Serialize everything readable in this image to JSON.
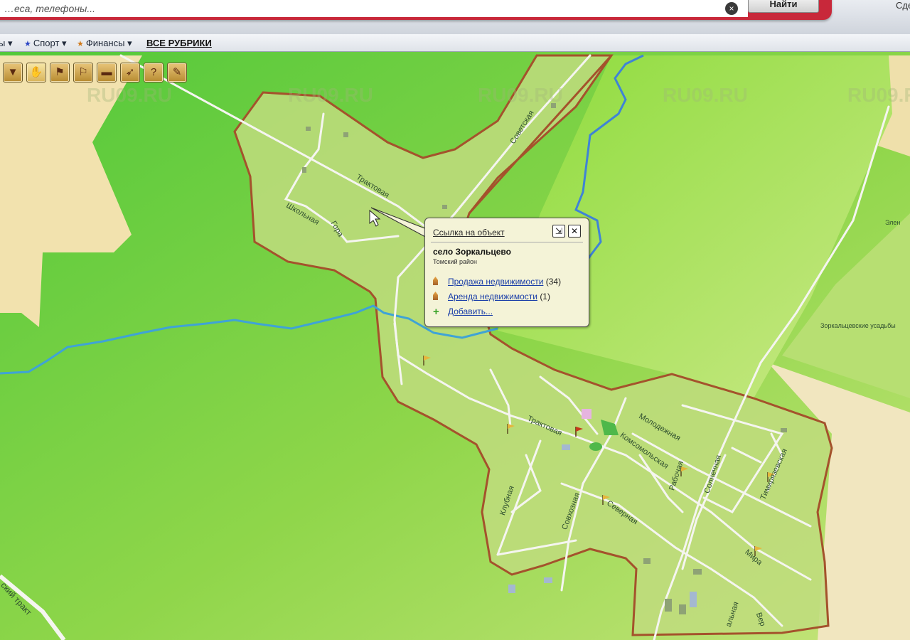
{
  "search": {
    "placeholder": "…еса, телефоны...",
    "button_label": "Найти",
    "clear_icon": "close-icon",
    "corner_text": "Сде"
  },
  "rubrics": [
    {
      "label": "ы ▾",
      "star": false
    },
    {
      "label": "Спорт ▾",
      "star": true,
      "star_color": "#2c46c4"
    },
    {
      "label": "Финансы ▾",
      "star": true,
      "star_color": "#d07a1a"
    },
    {
      "label": "ВСЕ РУБРИКИ",
      "star": false
    }
  ],
  "toolbar": {
    "tools": [
      {
        "icon": "zoom-glass-icon",
        "glyph": "▼"
      },
      {
        "icon": "hand-pan-icon",
        "glyph": "✋",
        "active": true
      },
      {
        "icon": "flag-icon",
        "glyph": "⚑"
      },
      {
        "icon": "flag-remove-icon",
        "glyph": "⚐"
      },
      {
        "icon": "ruler-icon",
        "glyph": "▬"
      },
      {
        "icon": "route-icon",
        "glyph": "➶"
      },
      {
        "icon": "help-icon",
        "glyph": "?"
      },
      {
        "icon": "eraser-icon",
        "glyph": "✎"
      }
    ]
  },
  "watermark": "RU09.RU",
  "popup": {
    "title": "Ссылка на объект",
    "place": "село Зоркальцево",
    "district": "Томский район",
    "links": [
      {
        "label": "Продажа недвижимости",
        "count": "(34)",
        "icon": "houses-icon"
      },
      {
        "label": "Аренда недвижимости",
        "count": "(1)",
        "icon": "houses-icon"
      },
      {
        "label": "Добавить...",
        "count": "",
        "icon": "plus-icon"
      }
    ],
    "pin_icon": "pin-icon",
    "close_icon": "close-icon"
  },
  "map_labels": {
    "street_traktovaya": "Трактовая",
    "street_traktovaya2": "Трактовая",
    "street_sovetskaya": "Советская",
    "street_shkolnaya": "Школьная",
    "street_gora": "Гора",
    "street_molodezhnaya": "Молодежная",
    "street_komsomolskaya": "Комсомольская",
    "street_rabochaya": "Рабочая",
    "street_solnechnaya": "Солнечная",
    "street_timiryazevskaya": "Тимирязевская",
    "street_klubnaya": "Клубная",
    "street_sovkhoznaya": "Совхозная",
    "street_severnaya": "Северная",
    "street_mira": "Мира",
    "area_elen": "Элен",
    "area_usadby": "Зоркальцевские усадьбы",
    "road_trakt": "ский тракт",
    "street_bottom1": "альная",
    "street_bottom2": "Вер"
  }
}
